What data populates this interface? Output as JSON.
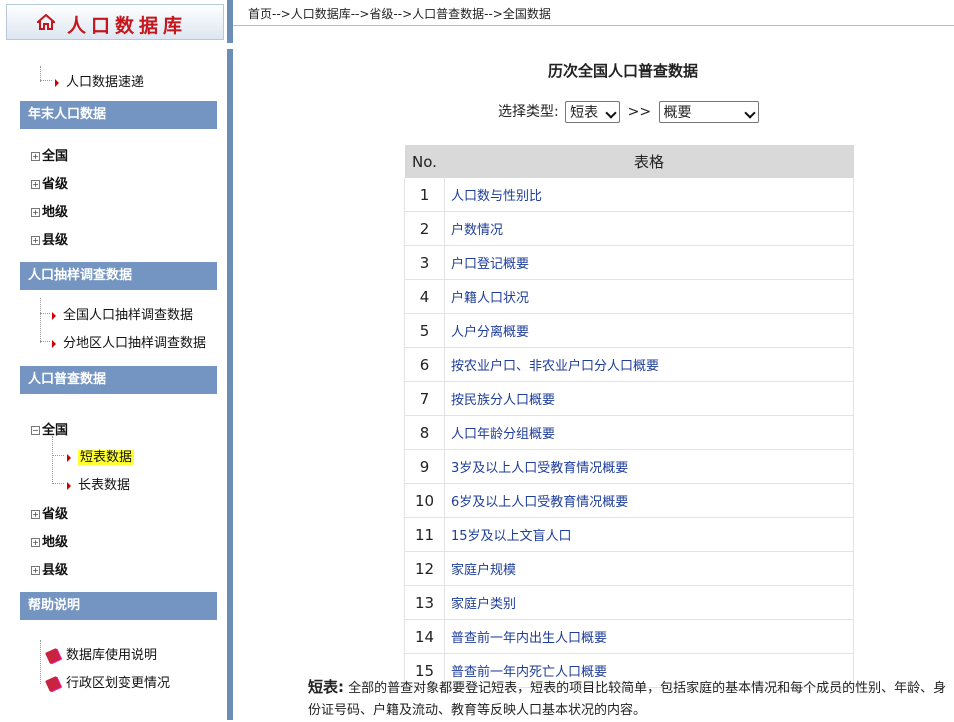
{
  "logo": {
    "title": "人口数据库",
    "icon": "home-icon"
  },
  "breadcrumb": "首页-->人口数据库-->省级-->人口普查数据-->全国数据",
  "sidebar": {
    "quick_link": "人口数据速递",
    "sections": [
      {
        "title": "年末人口数据",
        "items": [
          "全国",
          "省级",
          "地级",
          "县级"
        ]
      },
      {
        "title": "人口抽样调查数据",
        "items": [
          "全国人口抽样调查数据",
          "分地区人口抽样调查数据"
        ]
      },
      {
        "title": "人口普查数据",
        "items": [
          "全国",
          "短表数据",
          "长表数据",
          "省级",
          "地级",
          "县级"
        ]
      },
      {
        "title": "帮助说明",
        "items": [
          "数据库使用说明",
          "行政区划变更情况"
        ]
      }
    ]
  },
  "main": {
    "title": "历次全国人口普查数据",
    "type_label": "选择类型:",
    "type_select": "短表",
    "separator": ">>",
    "subtype_select": "概要",
    "table": {
      "headers": [
        "No.",
        "表格"
      ],
      "rows": [
        [
          "1",
          "人口数与性别比"
        ],
        [
          "2",
          "户数情况"
        ],
        [
          "3",
          "户口登记概要"
        ],
        [
          "4",
          "户籍人口状况"
        ],
        [
          "5",
          "人户分离概要"
        ],
        [
          "6",
          "按农业户口、非农业户口分人口概要"
        ],
        [
          "7",
          "按民族分人口概要"
        ],
        [
          "8",
          "人口年龄分组概要"
        ],
        [
          "9",
          "3岁及以上人口受教育情况概要"
        ],
        [
          "10",
          "6岁及以上人口受教育情况概要"
        ],
        [
          "11",
          "15岁及以上文盲人口"
        ],
        [
          "12",
          "家庭户规模"
        ],
        [
          "13",
          "家庭户类别"
        ],
        [
          "14",
          "普查前一年内出生人口概要"
        ],
        [
          "15",
          "普查前一年内死亡人口概要"
        ]
      ]
    },
    "footnote": {
      "term": "短表:",
      "text": "全部的普查对象都要登记短表，短表的项目比较简单，包括家庭的基本情况和每个成员的性别、年龄、身份证号码、户籍及流动、教育等反映人口基本状况的内容。"
    }
  },
  "colors": {
    "section_header": "#7494c1",
    "separator": "#6d8cb6",
    "link": "#1f3e9a",
    "highlight": "#ffff33",
    "logo_text": "#c4161c"
  }
}
